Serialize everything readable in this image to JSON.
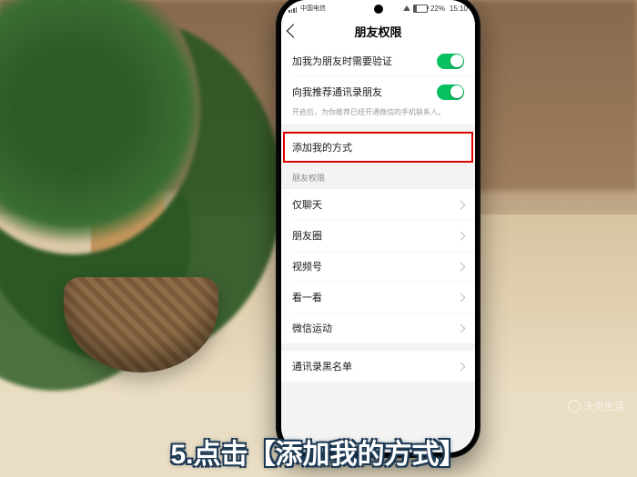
{
  "status": {
    "battery_pct": "22%",
    "time": "15:10"
  },
  "header": {
    "title": "朋友权限"
  },
  "toggles": [
    {
      "label": "加我为朋友时需要验证",
      "on": true
    },
    {
      "label": "向我推荐通讯录朋友",
      "on": true,
      "desc": "开启后，为你推荐已经开通微信的手机联系人。"
    }
  ],
  "highlight_row": {
    "label": "添加我的方式"
  },
  "section_header": "朋友权限",
  "menu": [
    {
      "label": "仅聊天"
    },
    {
      "label": "朋友圈"
    },
    {
      "label": "视频号"
    },
    {
      "label": "看一看"
    },
    {
      "label": "微信运动"
    }
  ],
  "menu2": [
    {
      "label": "通讯录黑名单"
    }
  ],
  "caption": "5.点击【添加我的方式】",
  "watermark": "天奇生活"
}
